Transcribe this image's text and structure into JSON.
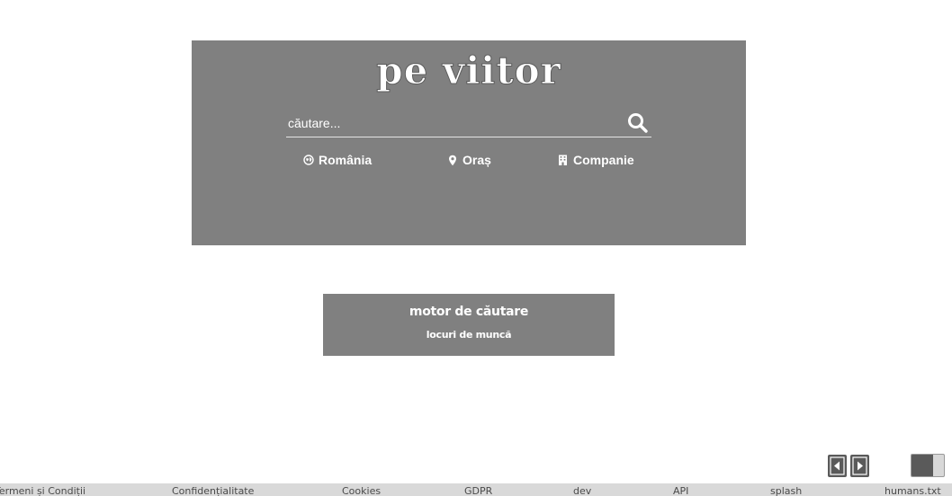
{
  "hero": {
    "logo_text": "pe viitor",
    "search": {
      "placeholder": "căutare...",
      "value": "",
      "button_icon": "search-icon"
    },
    "filters": [
      {
        "icon": "globe-icon",
        "label": "România"
      },
      {
        "icon": "map-pin-icon",
        "label": "Oraș"
      },
      {
        "icon": "building-icon",
        "label": "Companie"
      }
    ]
  },
  "tagline": {
    "main": "motor de căutare",
    "sub": "locuri de muncă"
  },
  "controls": {
    "prev_icon": "triangle-left-icon",
    "next_icon": "triangle-right-icon",
    "theme_icon": "theme-toggle-icon"
  },
  "footer": {
    "links": [
      "Termeni și Condiții",
      "Confidențialitate",
      "Cookies",
      "GDPR",
      "dev",
      "API",
      "splash",
      "humans.txt"
    ]
  },
  "colors": {
    "panel": "#808080",
    "text_on_panel": "#ffffff",
    "footer_bg": "#d9d9d9",
    "control": "#5a5a5a"
  }
}
